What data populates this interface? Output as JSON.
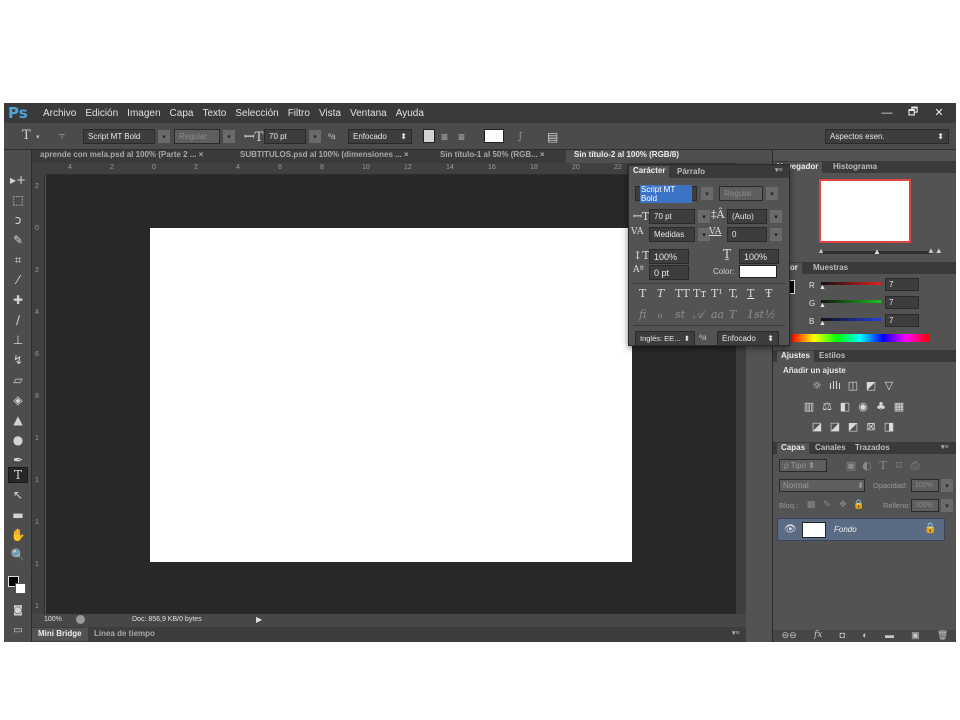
{
  "app": {
    "logo": "Ps"
  },
  "menu": [
    "Archivo",
    "Edición",
    "Imagen",
    "Capa",
    "Texto",
    "Selección",
    "Filtro",
    "Vista",
    "Ventana",
    "Ayuda"
  ],
  "window_controls": {
    "minimize": "—",
    "restore": "🗗",
    "close": "✕"
  },
  "options": {
    "tool_glyph": "T",
    "font_family": "Script MT Bold",
    "font_style": "Regular",
    "font_size": "70 pt",
    "aa_label": "ªa",
    "antialias": "Enfocado",
    "workspace": "Aspectos esen."
  },
  "tabs": [
    {
      "label": "aprende con mela.psd al 100% (Parte 2 ...",
      "close": "×"
    },
    {
      "label": "SUBTITULOS.psd al 100% (dimensiones ...",
      "close": "×"
    },
    {
      "label": "Sin título-1 al 50% (RGB...",
      "close": "×"
    },
    {
      "label": "Sin título-2 al 100% (RGB/8)",
      "close": ""
    }
  ],
  "ruler_h": [
    "4",
    "2",
    "0",
    "2",
    "4",
    "6",
    "8",
    "10",
    "12",
    "14",
    "16",
    "18",
    "20",
    "22"
  ],
  "ruler_v": [
    "2",
    "0",
    "2",
    "4",
    "6",
    "8",
    "1",
    "1",
    "1",
    "1",
    "1"
  ],
  "status": {
    "zoom": "100%",
    "doc": "Doc: 856,9 KB/0 bytes"
  },
  "bottom_tabs": [
    "Mini Bridge",
    "Línea de tiempo"
  ],
  "character_panel": {
    "tabs": [
      "Carácter",
      "Párrafo"
    ],
    "font_family": "Script MT Bold",
    "font_style": "Regular",
    "size": "70 pt",
    "leading": "(Auto)",
    "kerning": "Medidas",
    "tracking": "0",
    "vscale": "100%",
    "hscale": "100%",
    "baseline": "0 pt",
    "color_label": "Color:",
    "color": "#ffffff",
    "language": "Inglés: EE...",
    "aa_label": "ªa",
    "antialias": "Enfocado",
    "style_glyphs": [
      "T",
      "T",
      "TT",
      "Tт",
      "T¹",
      "T,",
      "T",
      "Ŧ"
    ],
    "opentype_glyphs": [
      "ﬁ",
      "ℴ",
      "st",
      "𝒜",
      "aa",
      "T",
      "1st",
      "½"
    ]
  },
  "navigator": {
    "tabs": [
      "Navegador",
      "Histograma"
    ]
  },
  "color_panel": {
    "tabs": [
      "Color",
      "Muestras"
    ],
    "channels": [
      {
        "name": "R",
        "value": "7",
        "color": "#e02020"
      },
      {
        "name": "G",
        "value": "7",
        "color": "#20c020"
      },
      {
        "name": "B",
        "value": "7",
        "color": "#2040e0"
      }
    ]
  },
  "adjustments": {
    "tabs": [
      "Ajustes",
      "Estilos"
    ],
    "title": "Añadir un ajuste"
  },
  "layers": {
    "tabs": [
      "Capas",
      "Canales",
      "Trazados"
    ],
    "filter": "ρ Tipo",
    "blend": "Normal",
    "opacity_label": "Opacidad:",
    "opacity": "100%",
    "lock_label": "Bloq.:",
    "fill_label": "Relleno:",
    "fill": "100%",
    "items": [
      {
        "name": "Fondo",
        "locked": true
      }
    ],
    "footer_icons": [
      "ɢᴅ",
      "fx",
      "◘",
      "◐",
      "▬",
      "▣",
      "🗑"
    ]
  }
}
